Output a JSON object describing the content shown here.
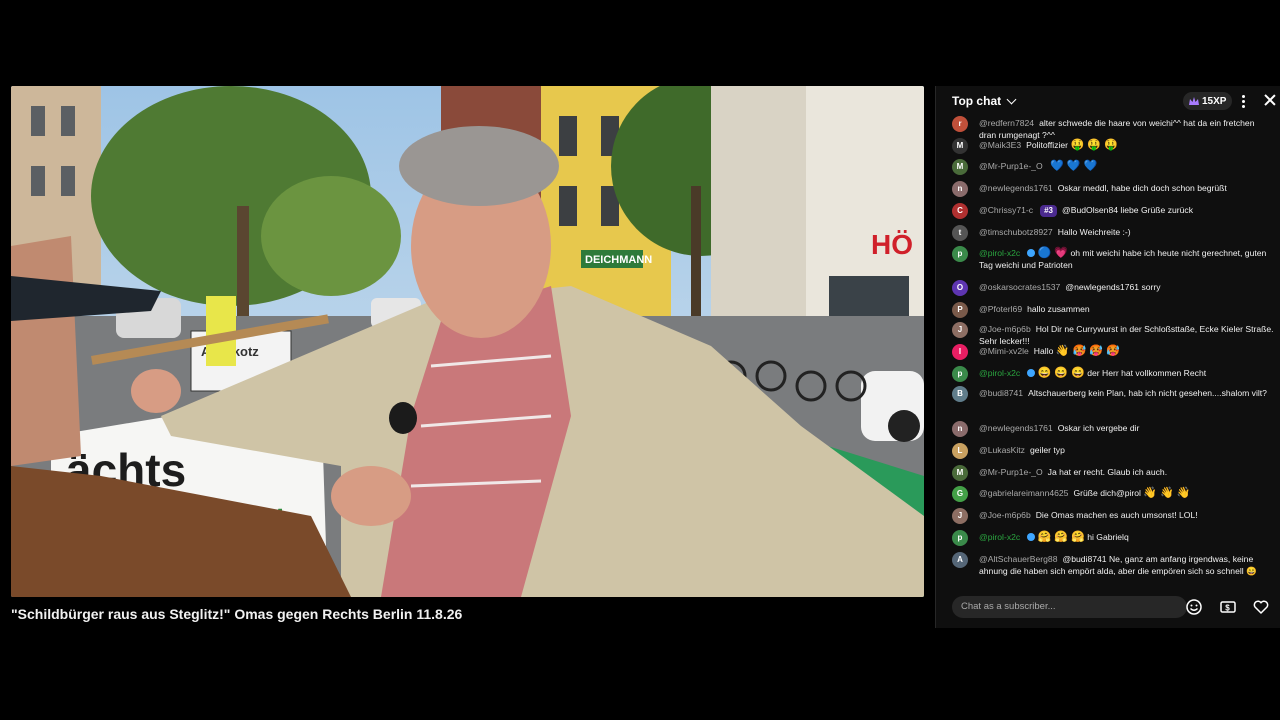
{
  "video": {
    "title": "\"Schildbürger raus aus Steglitz!\" Omas gegen Rechts Berlin 11.8.26",
    "scene": {
      "store_sign": "DEICHMANN",
      "store_sign_2": "HÖ",
      "banner_text": "ächts",
      "banner_text_2": "ument",
      "sign_text": "AHN kotz"
    }
  },
  "chat": {
    "header": {
      "title": "Top chat",
      "xp_label": "15XP"
    },
    "input_placeholder": "Chat as a subscriber...",
    "messages": [
      {
        "avatar": "r",
        "avatar_color": "#c0503a",
        "author": "@redfern7824",
        "member": false,
        "text": "alter schwede die haare von weichi^^ hat da ein fretchen dran rumgenagt ?^^",
        "lines": 2
      },
      {
        "avatar": "M",
        "avatar_color": "#333333",
        "author": "@Maik3E3",
        "member": false,
        "text": "Politoffizier",
        "emoji": "🤑 🤑 🤑"
      },
      {
        "avatar": "M",
        "avatar_color": "#4a6b3a",
        "author": "@Mr-Purp1e-_O",
        "member": false,
        "text": "",
        "emoji": "💙 💙 💙"
      },
      {
        "avatar": "n",
        "avatar_color": "#8a6b6b",
        "author": "@newlegends1761",
        "member": false,
        "text": "Oskar meddl, habe dich doch schon begrüßt"
      },
      {
        "avatar": "C",
        "avatar_color": "#b03030",
        "author": "@Chrissy71-c",
        "member": false,
        "rank": "#3",
        "text": "@BudOlsen84 liebe Grüße zurück"
      },
      {
        "avatar": "t",
        "avatar_color": "#555555",
        "author": "@timschubotz8927",
        "member": false,
        "text": "Hallo Weichreite :-)"
      },
      {
        "avatar": "p",
        "avatar_color": "#3a8a4a",
        "author": "@pirol-x2c",
        "member": true,
        "verified": true,
        "emoji": "🔵 💗",
        "text": "oh mit weichi habe ich heute nicht gerechnet, guten Tag weichi und Patrioten",
        "lines": 2
      },
      {
        "avatar": "O",
        "avatar_color": "#5e35b1",
        "author": "@oskarsocrates1537",
        "member": false,
        "text": "@newlegends1761 sorry"
      },
      {
        "avatar": "P",
        "avatar_color": "#7a5a4a",
        "author": "@Pfoterl69",
        "member": false,
        "text": "hallo zusammen"
      },
      {
        "avatar": "J",
        "avatar_color": "#8d6e63",
        "author": "@Joe-m6p6b",
        "member": false,
        "text": "Hol Dir ne Currywurst in der Schloßsttaße, Ecke Kieler Straße. Sehr lecker!!!",
        "lines": 2
      },
      {
        "avatar": "I",
        "avatar_color": "#e91e63",
        "author": "@Mimi-xv2le",
        "member": false,
        "text": "Hallo",
        "emoji": "👋 🥵 🥵 🥵"
      },
      {
        "avatar": "p",
        "avatar_color": "#3a8a4a",
        "author": "@pirol-x2c",
        "member": true,
        "verified": true,
        "emoji": "😄 😄 😄",
        "text": "der Herr hat vollkommen Recht"
      },
      {
        "avatar": "B",
        "avatar_color": "#607d8b",
        "author": "@budi8741",
        "member": false,
        "text": "Altschauerberg kein Plan, hab ich nicht gesehen....shalom vilt?",
        "lines": 2
      },
      {
        "avatar": "n",
        "avatar_color": "#8a6b6b",
        "author": "@newlegends1761",
        "member": false,
        "text": "Oskar ich vergebe dir"
      },
      {
        "avatar": "L",
        "avatar_color": "#c8a060",
        "author": "@LukasKitz",
        "member": false,
        "text": "geiler typ"
      },
      {
        "avatar": "M",
        "avatar_color": "#4a6b3a",
        "author": "@Mr-Purp1e-_O",
        "member": false,
        "text": "Ja hat er recht. Glaub ich auch."
      },
      {
        "avatar": "G",
        "avatar_color": "#43a047",
        "author": "@gabrielareimann4625",
        "member": false,
        "text": "Grüße dich@pirol",
        "emoji": "👋 👋 👋"
      },
      {
        "avatar": "J",
        "avatar_color": "#8d6e63",
        "author": "@Joe-m6p6b",
        "member": false,
        "text": "Die Omas machen es auch umsonst! LOL!"
      },
      {
        "avatar": "p",
        "avatar_color": "#3a8a4a",
        "author": "@pirol-x2c",
        "member": true,
        "verified": true,
        "emoji": "🤗 🤗 🤗",
        "text": "hi Gabrielq"
      },
      {
        "avatar": "A",
        "avatar_color": "#556677",
        "author": "@AltSchauerBerg88",
        "member": false,
        "text": "@budi8741 Ne, ganz am anfang irgendwas, keine ahnung die haben sich empört alda, aber die empören sich so schnell 😄",
        "lines": 2
      }
    ]
  }
}
